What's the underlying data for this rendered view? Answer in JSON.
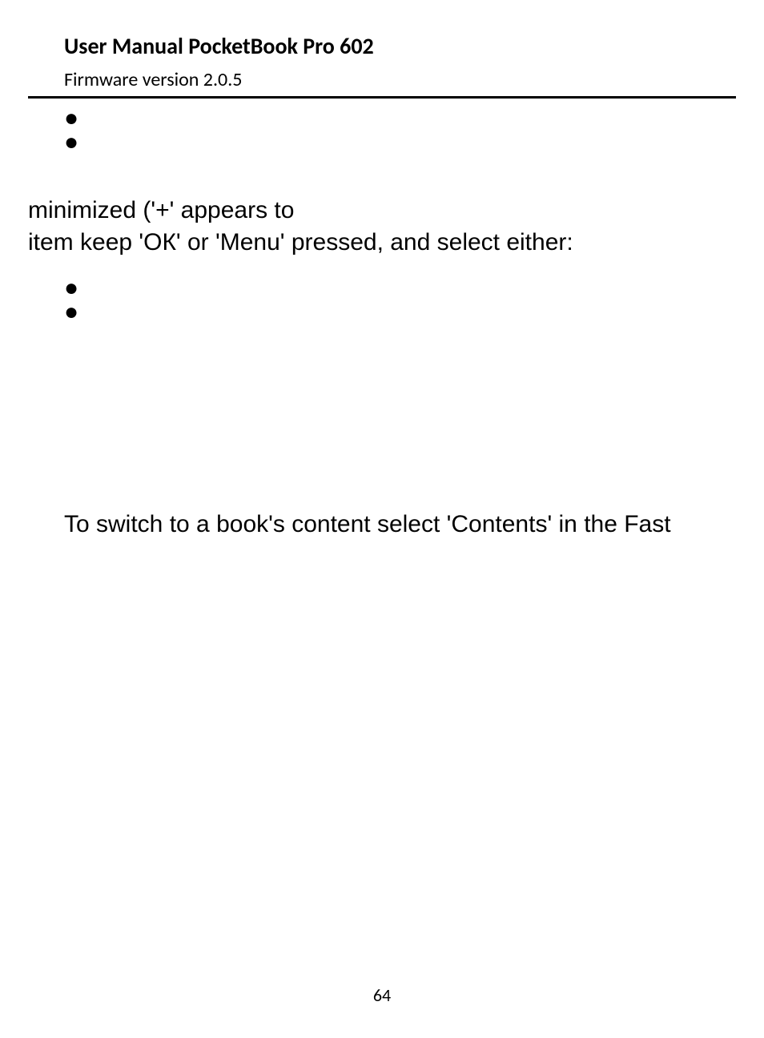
{
  "header": {
    "title": "User Manual PocketBook Pro 602",
    "subtitle": "Firmware version 2.0.5"
  },
  "body": {
    "bullets1": [
      "",
      ""
    ],
    "paragraph1_line1": "minimized ('+' appears to",
    "paragraph1_line2": "item keep 'ОК' or 'Menu' pressed, and select either:",
    "bullets2": [
      "",
      ""
    ],
    "paragraph2": "To switch to a book's content select 'Contents' in the Fast"
  },
  "footer": {
    "page_number": "64"
  }
}
